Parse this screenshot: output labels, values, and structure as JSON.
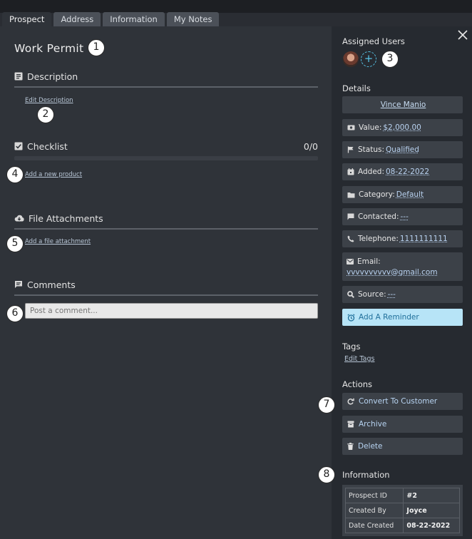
{
  "tabs": [
    "Prospect",
    "Address",
    "Information",
    "My Notes"
  ],
  "title": "Work Permit",
  "callouts": [
    "1",
    "2",
    "3",
    "4",
    "5",
    "6",
    "7",
    "8"
  ],
  "description": {
    "heading": "Description",
    "link": "Edit Description"
  },
  "checklist": {
    "heading": "Checklist",
    "count": "0/0",
    "link": "Add a new product"
  },
  "attachments": {
    "heading": "File Attachments",
    "link": "Add a file attachment"
  },
  "comments": {
    "heading": "Comments",
    "placeholder": "Post a comment..."
  },
  "sidebar": {
    "assigned_users": "Assigned Users",
    "details": "Details",
    "owner": "Vince Manio",
    "value_label": "Value:",
    "value": "$2,000.00",
    "status_label": "Status:",
    "status": "Qualified",
    "added_label": "Added:",
    "added": "08-22-2022",
    "category_label": "Category:",
    "category": "Default",
    "contacted_label": "Contacted:",
    "contacted": "---",
    "telephone_label": "Telephone:",
    "telephone": "1111111111",
    "email_label": "Email:",
    "email": "vvvvvvvvvv@gmail.com",
    "source_label": "Source:",
    "source": "---",
    "reminder": "Add A Reminder",
    "tags": "Tags",
    "edit_tags": "Edit Tags",
    "actions": "Actions",
    "convert": "Convert To Customer",
    "archive": "Archive",
    "delete": "Delete",
    "information": "Information",
    "info_rows": [
      {
        "k": "Prospect ID",
        "v": "#2"
      },
      {
        "k": "Created By",
        "v": "Joyce"
      },
      {
        "k": "Date Created",
        "v": "08-22-2022"
      }
    ]
  },
  "colors": {
    "accent": "#57c3e6",
    "reminder_bg": "#b7e4f7",
    "link": "#b8d4f2"
  }
}
